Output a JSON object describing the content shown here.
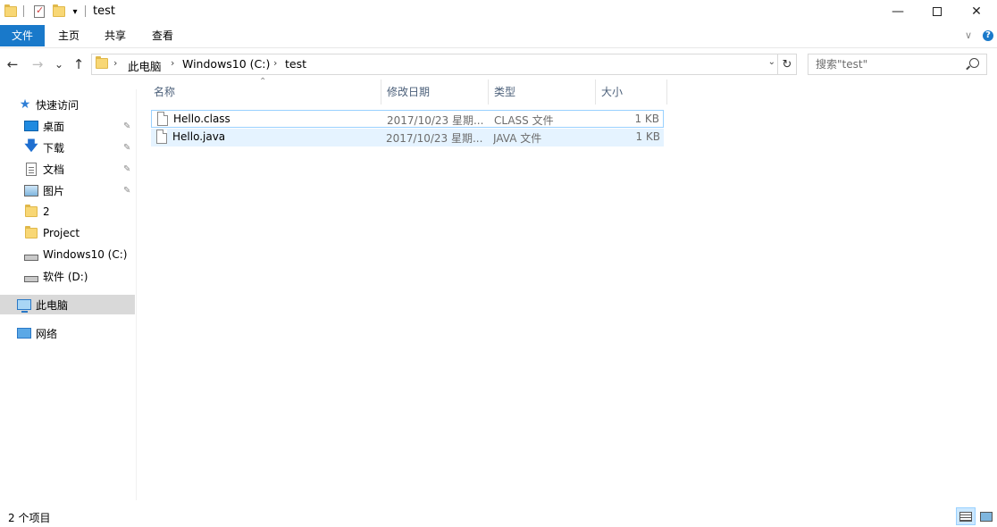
{
  "window": {
    "title": "test",
    "minimize_glyph": "—",
    "close_glyph": "✕",
    "qa_dropdown_glyph": "▾"
  },
  "ribbon": {
    "tabs": [
      {
        "label": "文件"
      },
      {
        "label": "主页"
      },
      {
        "label": "共享"
      },
      {
        "label": "查看"
      }
    ],
    "expand_glyph": "∨",
    "help_glyph": "?"
  },
  "nav": {
    "back_glyph": "←",
    "forward_glyph": "→",
    "recent_glyph": "⌄",
    "up_glyph": "↑",
    "breadcrumb": [
      "此电脑",
      "Windows10 (C:)",
      "test"
    ],
    "chevron": "›",
    "dropdown_glyph": "⌄",
    "refresh_glyph": "↻"
  },
  "search": {
    "placeholder": "搜索\"test\""
  },
  "sidebar": {
    "quick_access": "快速访问",
    "items": [
      {
        "label": "桌面",
        "icon": "desktop-icon",
        "pinned": true
      },
      {
        "label": "下载",
        "icon": "download-icon",
        "pinned": true
      },
      {
        "label": "文档",
        "icon": "documents-icon",
        "pinned": true
      },
      {
        "label": "图片",
        "icon": "pictures-icon",
        "pinned": true
      },
      {
        "label": "2",
        "icon": "folder-icon",
        "pinned": false
      },
      {
        "label": "Project",
        "icon": "folder-icon",
        "pinned": false
      },
      {
        "label": "Windows10 (C:)",
        "icon": "drive-icon",
        "pinned": false
      },
      {
        "label": "软件 (D:)",
        "icon": "drive-icon",
        "pinned": false
      }
    ],
    "this_pc": "此电脑",
    "network": "网络",
    "pin_glyph": "📌"
  },
  "file_list": {
    "columns": [
      {
        "label": "名称"
      },
      {
        "label": "修改日期"
      },
      {
        "label": "类型"
      },
      {
        "label": "大小"
      }
    ],
    "sort_glyph": "⌃",
    "rows": [
      {
        "name": "Hello.class",
        "date": "2017/10/23 星期...",
        "type": "CLASS 文件",
        "size": "1 KB"
      },
      {
        "name": "Hello.java",
        "date": "2017/10/23 星期...",
        "type": "JAVA 文件",
        "size": "1 KB"
      }
    ]
  },
  "status": {
    "item_count": "2 个项目"
  },
  "colors": {
    "accent": "#1979ca",
    "selection_border": "#99d1ff",
    "hover_bg": "#e5f3ff",
    "sidebar_selected": "#d9d9d9"
  }
}
